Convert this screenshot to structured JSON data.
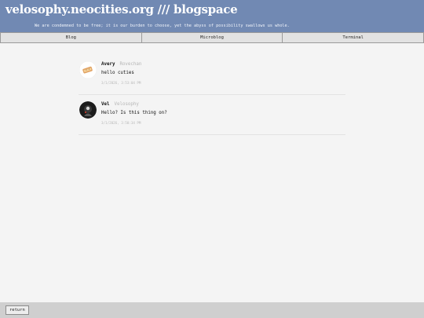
{
  "header": {
    "title": "velosophy.neocities.org /// blogspace",
    "tagline": "We are condemned to be free; it is our burden to choose, yet the abyss of possibility swallows us whole."
  },
  "nav": {
    "tabs": [
      {
        "label": "Blog"
      },
      {
        "label": "Microblog"
      },
      {
        "label": "Terminal"
      }
    ]
  },
  "posts": [
    {
      "name": "Avery",
      "handle": "Rovechan",
      "text": "hello cuties",
      "time": "3/1/2026, 3:53:04 PM",
      "avatar_icon": "toast-avatar-icon"
    },
    {
      "name": "Vel",
      "handle": "Velosophy",
      "text": "Hello? Is this thing on?",
      "time": "3/1/2026, 3:50:34 PM",
      "avatar_icon": "dark-figure-avatar-icon"
    }
  ],
  "footer": {
    "return_label": "return"
  },
  "colors": {
    "header_bg": "#7189b3",
    "page_bg": "#f4f4f4",
    "footer_bg": "#cfcfcf"
  }
}
